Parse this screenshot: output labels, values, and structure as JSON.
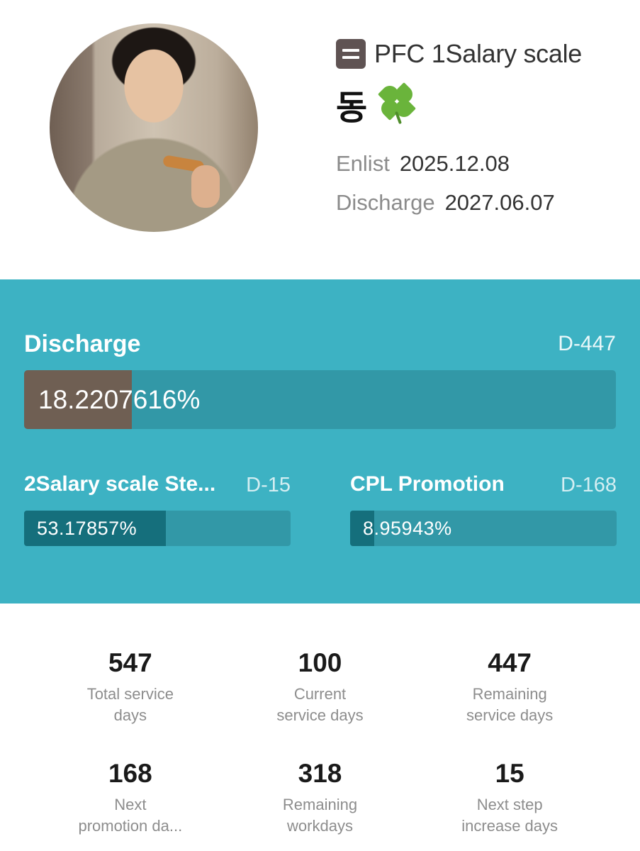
{
  "profile": {
    "rank": "PFC 1Salary scale",
    "name": "동",
    "name_emoji": "clover-icon",
    "enlist_label": "Enlist",
    "enlist_date": "2025.12.08",
    "discharge_label": "Discharge",
    "discharge_date": "2027.06.07"
  },
  "discharge_progress": {
    "title": "Discharge",
    "dday": "D-447",
    "percent_text": "18.2207616%",
    "percent": 18.2207616
  },
  "step_progress": {
    "title": "2Salary scale Ste...",
    "dday": "D-15",
    "percent_text": "53.17857%",
    "percent": 53.17857
  },
  "promotion_progress": {
    "title": "CPL Promotion",
    "dday": "D-168",
    "percent_text": "8.95943%",
    "percent": 8.95943
  },
  "stats": [
    {
      "value": "547",
      "label": "Total service\ndays"
    },
    {
      "value": "100",
      "label": "Current\nservice days"
    },
    {
      "value": "447",
      "label": "Remaining\nservice days"
    },
    {
      "value": "168",
      "label": "Next\npromotion da..."
    },
    {
      "value": "318",
      "label": "Remaining\nworkdays"
    },
    {
      "value": "15",
      "label": "Next step\nincrease days"
    }
  ],
  "colors": {
    "panel": "#3db2c3",
    "bar_track": "#3298a7",
    "main_fill": "#6f5f53",
    "sub_fill": "#156f7c",
    "rank_icon": "#5f5353"
  }
}
